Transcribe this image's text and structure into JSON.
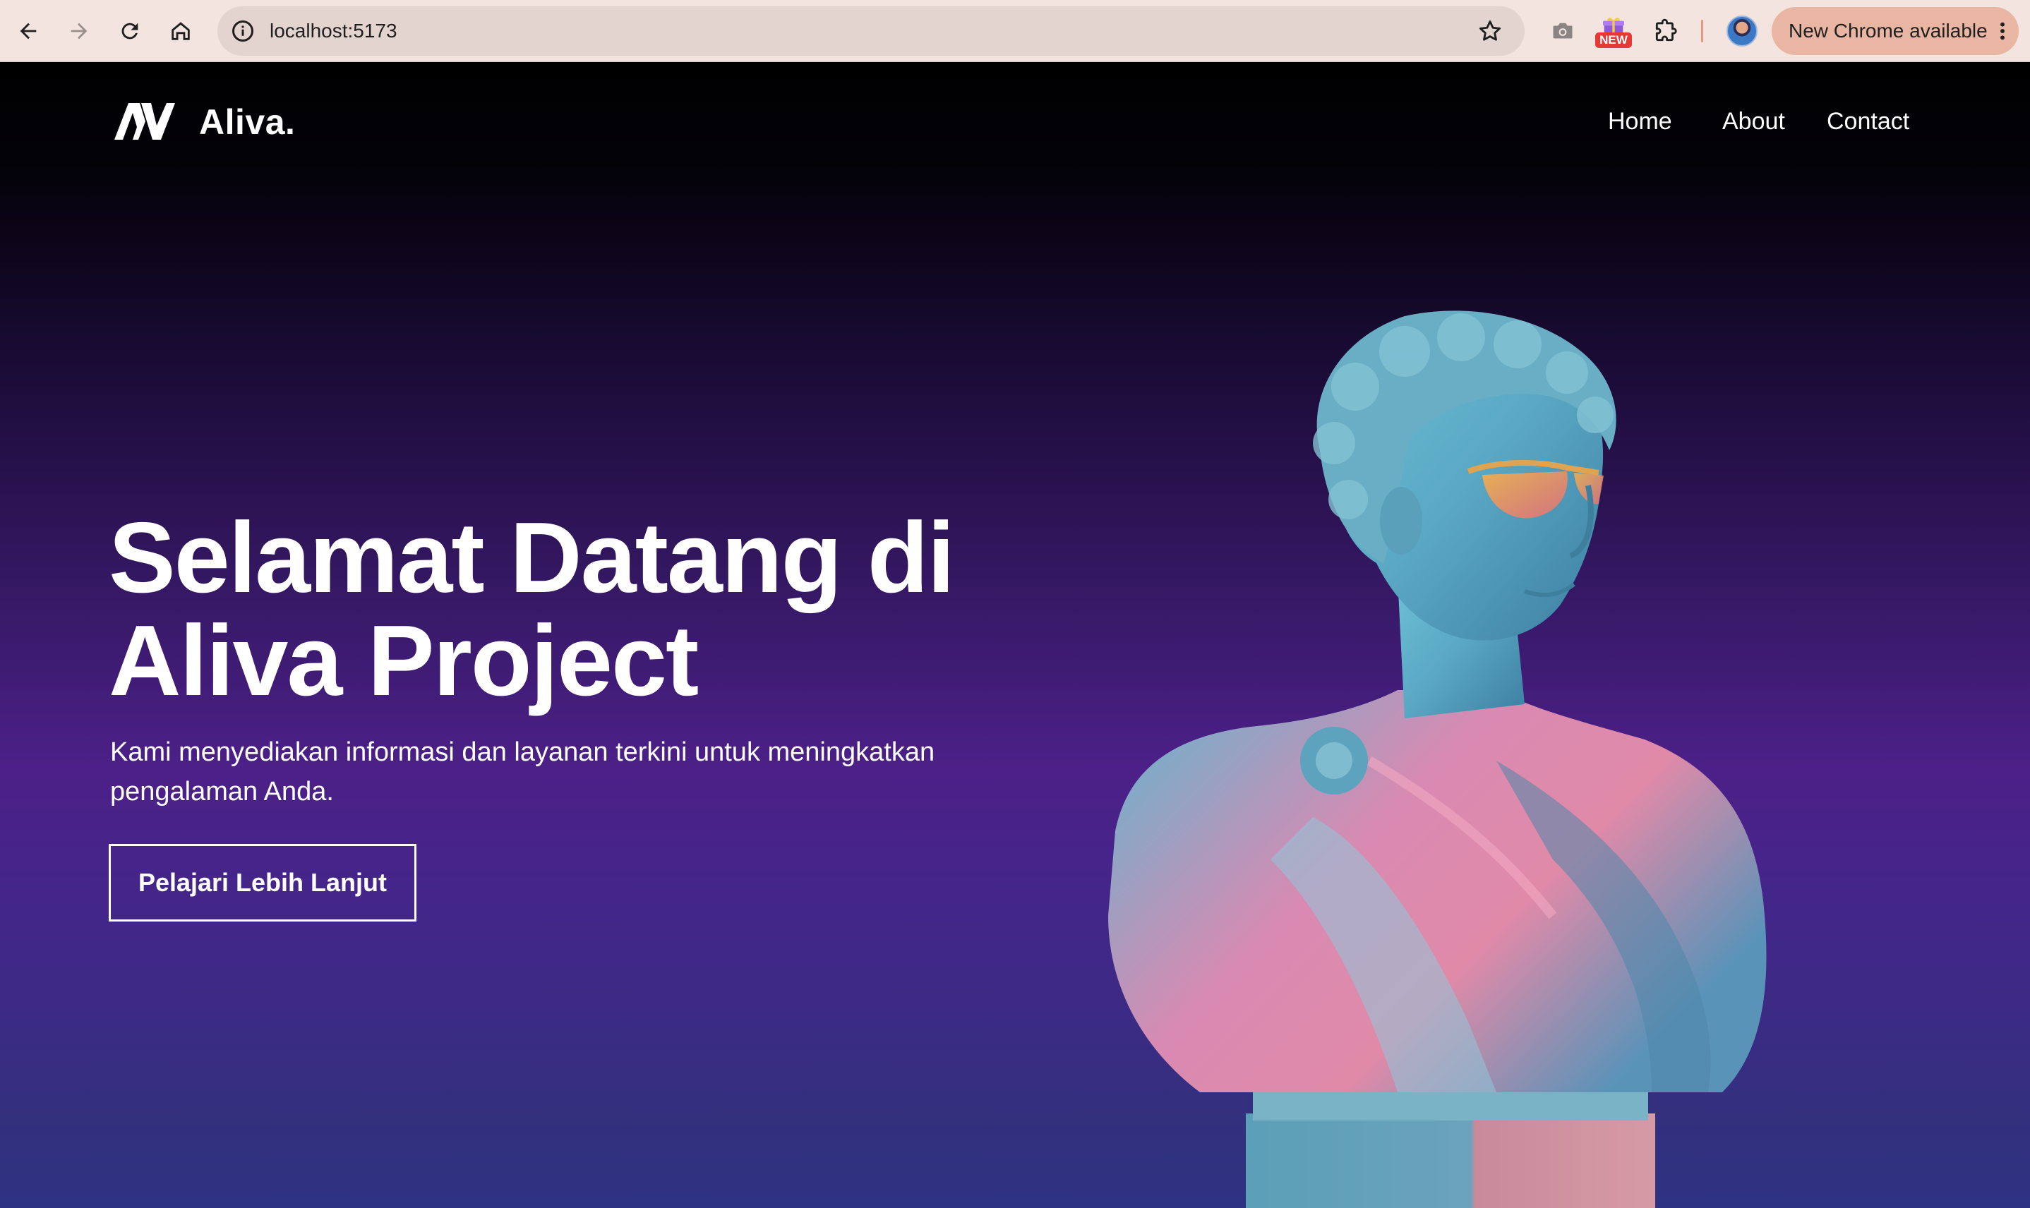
{
  "browser": {
    "url": "localhost:5173",
    "new_badge": "NEW",
    "update_label": "New Chrome available"
  },
  "site": {
    "brand": "Aliva.",
    "nav": [
      "Home",
      "About",
      "Contact"
    ]
  },
  "hero": {
    "title_line1": "Selamat Datang di",
    "title_line2": "Aliva Project",
    "subtitle_line1": "Kami menyediakan informasi dan layanan terkini untuk meningkatkan",
    "subtitle_line2": "pengalaman Anda.",
    "cta_label": "Pelajari Lebih Lanjut"
  },
  "colors": {
    "chrome_bar": "#f3e4df",
    "update_pill": "#e8b6a3",
    "hero_top": "#000000",
    "hero_mid": "#4c2088",
    "hero_bottom": "#2d3382",
    "text": "#ffffff"
  },
  "icons": [
    "back-arrow-icon",
    "forward-arrow-icon",
    "reload-icon",
    "home-icon",
    "info-icon",
    "bookmark-star-icon",
    "camera-icon",
    "gift-icon",
    "extensions-puzzle-icon",
    "profile-avatar",
    "more-vert-icon",
    "aliva-logo",
    "statue-bust-image"
  ]
}
